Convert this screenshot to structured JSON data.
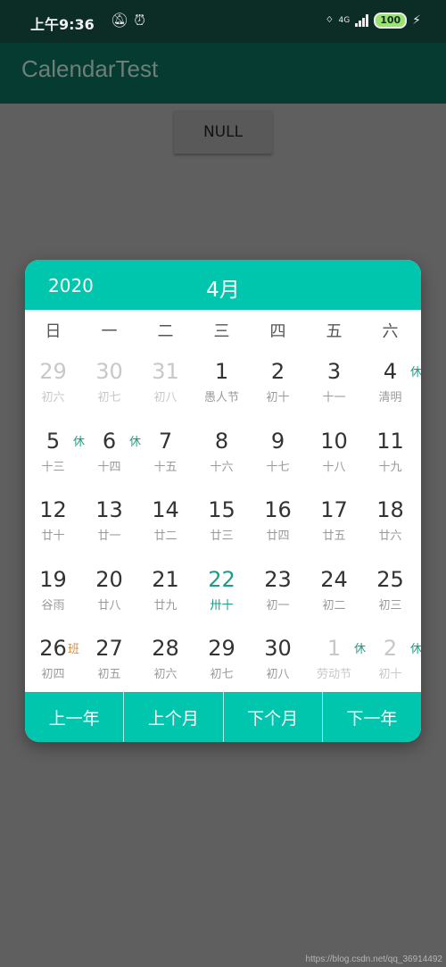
{
  "status_bar": {
    "time": "上午9:36",
    "network": "4G",
    "battery": "100"
  },
  "app": {
    "title": "CalendarTest"
  },
  "null_button": {
    "label": "NULL"
  },
  "calendar": {
    "year": "2020",
    "month": "4月",
    "weekdays": [
      "日",
      "一",
      "二",
      "三",
      "四",
      "五",
      "六"
    ],
    "days": [
      {
        "day": "29",
        "lunar": "初六",
        "dim": true
      },
      {
        "day": "30",
        "lunar": "初七",
        "dim": true
      },
      {
        "day": "31",
        "lunar": "初八",
        "dim": true
      },
      {
        "day": "1",
        "lunar": "愚人节"
      },
      {
        "day": "2",
        "lunar": "初十"
      },
      {
        "day": "3",
        "lunar": "十一"
      },
      {
        "day": "4",
        "lunar": "清明",
        "badge": "休"
      },
      {
        "day": "5",
        "lunar": "十三",
        "badge": "休"
      },
      {
        "day": "6",
        "lunar": "十四",
        "badge": "休"
      },
      {
        "day": "7",
        "lunar": "十五"
      },
      {
        "day": "8",
        "lunar": "十六"
      },
      {
        "day": "9",
        "lunar": "十七"
      },
      {
        "day": "10",
        "lunar": "十八"
      },
      {
        "day": "11",
        "lunar": "十九"
      },
      {
        "day": "12",
        "lunar": "廿十"
      },
      {
        "day": "13",
        "lunar": "廿一"
      },
      {
        "day": "14",
        "lunar": "廿二"
      },
      {
        "day": "15",
        "lunar": "廿三"
      },
      {
        "day": "16",
        "lunar": "廿四"
      },
      {
        "day": "17",
        "lunar": "廿五"
      },
      {
        "day": "18",
        "lunar": "廿六"
      },
      {
        "day": "19",
        "lunar": "谷雨"
      },
      {
        "day": "20",
        "lunar": "廿八"
      },
      {
        "day": "21",
        "lunar": "廿九"
      },
      {
        "day": "22",
        "lunar": "卅十",
        "today": true
      },
      {
        "day": "23",
        "lunar": "初一"
      },
      {
        "day": "24",
        "lunar": "初二"
      },
      {
        "day": "25",
        "lunar": "初三"
      },
      {
        "day": "26",
        "lunar": "初四",
        "badge": "班",
        "badge_type": "work"
      },
      {
        "day": "27",
        "lunar": "初五"
      },
      {
        "day": "28",
        "lunar": "初六"
      },
      {
        "day": "29",
        "lunar": "初七"
      },
      {
        "day": "30",
        "lunar": "初八"
      },
      {
        "day": "1",
        "lunar": "劳动节",
        "dim": true,
        "badge": "休"
      },
      {
        "day": "2",
        "lunar": "初十",
        "dim": true,
        "badge": "休"
      }
    ],
    "footer": [
      "上一年",
      "上个月",
      "下个月",
      "下一年"
    ]
  },
  "watermark": "https://blog.csdn.net/qq_36914492",
  "colors": {
    "accent": "#00c6ae",
    "holiday": "#1c9b86",
    "workday": "#d98c3c",
    "appbar": "#063b31"
  }
}
